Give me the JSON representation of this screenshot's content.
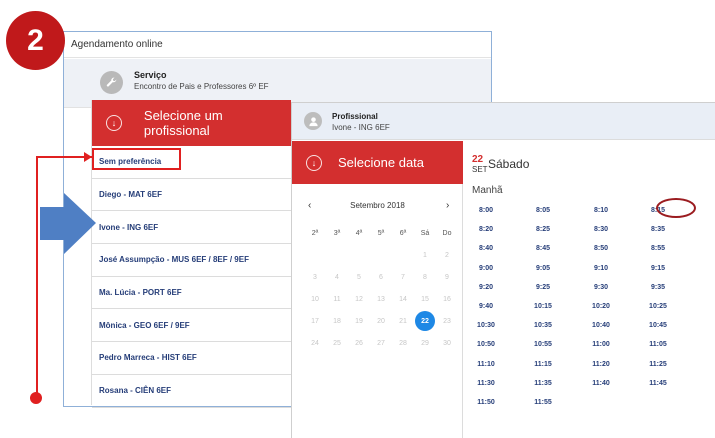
{
  "step_number": "2",
  "window": {
    "title": "Agendamento online"
  },
  "service": {
    "title": "Serviço",
    "subtitle": "Encontro de Pais e Professores   6º EF"
  },
  "professional_panel": {
    "header": "Selecione um profissional",
    "items": [
      "Sem preferência",
      "Diego - MAT 6EF",
      "Ivone - ING 6EF",
      "José Assumpção - MUS 6EF / 8EF / 9EF",
      "Ma. Lúcia - PORT 6EF",
      "Mônica - GEO 6EF / 9EF",
      "Pedro Marreca - HIST 6EF",
      "Rosana - CIÊN 6EF"
    ]
  },
  "selected_professional": {
    "title": "Profissional",
    "subtitle": "Ivone - ING 6EF"
  },
  "date_panel": {
    "header": "Selecione data"
  },
  "calendar": {
    "prev": "‹",
    "next": "›",
    "month_label": "Setembro 2018",
    "weekdays": [
      "2ª",
      "3ª",
      "4ª",
      "5ª",
      "6ª",
      "Sá",
      "Do"
    ],
    "weeks": [
      [
        "",
        "",
        "",
        "",
        "",
        "1",
        "2"
      ],
      [
        "3",
        "4",
        "5",
        "6",
        "7",
        "8",
        "9"
      ],
      [
        "10",
        "11",
        "12",
        "13",
        "14",
        "15",
        "16"
      ],
      [
        "17",
        "18",
        "19",
        "20",
        "21",
        "22",
        "23"
      ],
      [
        "24",
        "25",
        "26",
        "27",
        "28",
        "29",
        "30"
      ]
    ],
    "selected_day": "22"
  },
  "selected_date": {
    "day": "22",
    "month": "SET",
    "weekday": "Sábado",
    "period": "Manhã"
  },
  "time_slots": [
    [
      "8:00",
      "8:05",
      "8:10",
      "8:15"
    ],
    [
      "8:20",
      "8:25",
      "8:30",
      "8:35"
    ],
    [
      "8:40",
      "8:45",
      "8:50",
      "8:55"
    ],
    [
      "9:00",
      "9:05",
      "9:10",
      "9:15"
    ],
    [
      "9:20",
      "9:25",
      "9:30",
      "9:35"
    ],
    [
      "9:40",
      "10:15",
      "10:20",
      "10:25"
    ],
    [
      "10:30",
      "10:35",
      "10:40",
      "10:45"
    ],
    [
      "10:50",
      "10:55",
      "11:00",
      "11:05"
    ],
    [
      "11:10",
      "11:15",
      "11:20",
      "11:25"
    ],
    [
      "11:30",
      "11:35",
      "11:40",
      "11:45"
    ],
    [
      "11:50",
      "11:55",
      "",
      ""
    ]
  ],
  "highlighted_time": "8:15",
  "colors": {
    "accent_red": "#d32f2f",
    "badge_red": "#c0191b",
    "link_blue": "#253d78",
    "selected_blue": "#1e88e5",
    "arrow_blue": "#4f7fc4"
  }
}
